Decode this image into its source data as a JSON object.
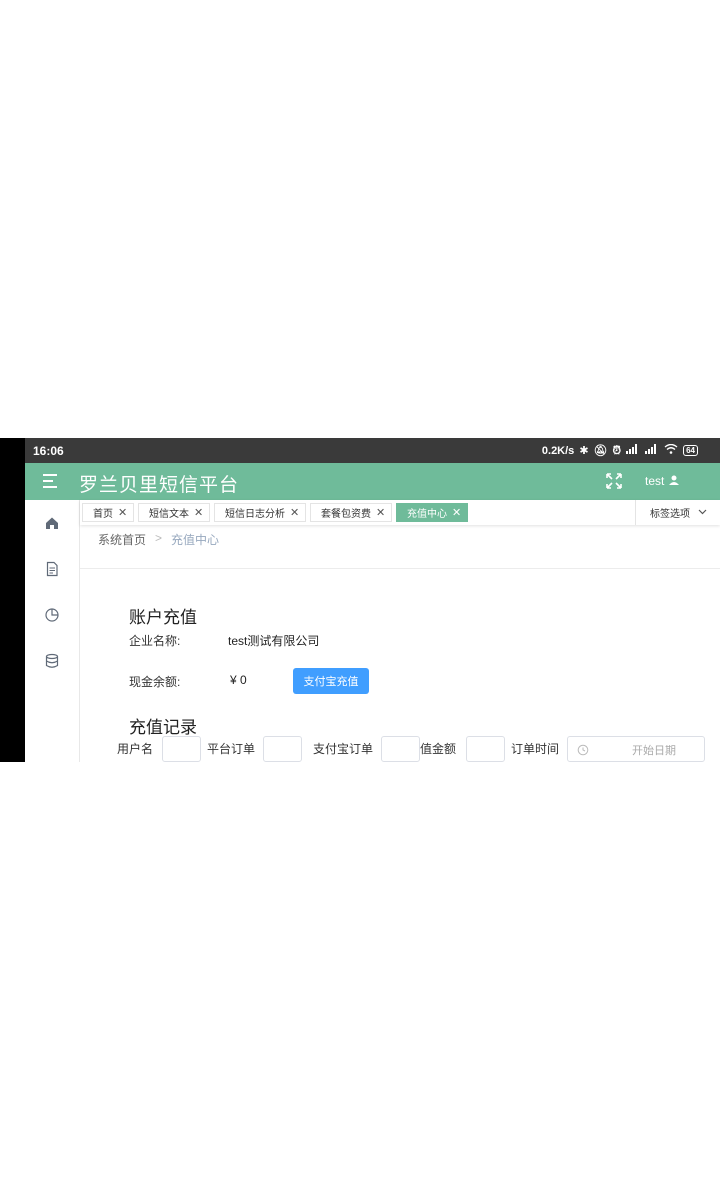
{
  "status_bar": {
    "time": "16:06",
    "speed": "0.2K/s",
    "battery": "64"
  },
  "header": {
    "title": "罗兰贝里短信平台",
    "username": "test"
  },
  "tags": [
    {
      "label": "首页",
      "active": false
    },
    {
      "label": "短信文本",
      "active": false
    },
    {
      "label": "短信日志分析",
      "active": false
    },
    {
      "label": "套餐包资费",
      "active": false
    },
    {
      "label": "充值中心",
      "active": true
    }
  ],
  "tag_options_label": "标签选项",
  "sidebar": {
    "icons": [
      "home-icon",
      "document-icon",
      "pie-chart-icon",
      "database-icon"
    ]
  },
  "breadcrumb": {
    "home": "系统首页",
    "current": "充值中心"
  },
  "account": {
    "section_title": "账户充值",
    "company_label": "企业名称:",
    "company_value": "test测试有限公司",
    "balance_label": "现金余额:",
    "balance_value": "¥ 0",
    "recharge_button": "支付宝充值"
  },
  "records": {
    "section_title": "充值记录",
    "filters": {
      "username": "用户名",
      "platform_order": "平台订单",
      "alipay_order": "支付宝订单",
      "amount": "值金额",
      "order_time": "订单时间"
    },
    "start_date_placeholder": "开始日期"
  },
  "colors": {
    "header": "#6fbb9a",
    "primary_button": "#409eff",
    "status_bar": "#3a3a3a"
  }
}
